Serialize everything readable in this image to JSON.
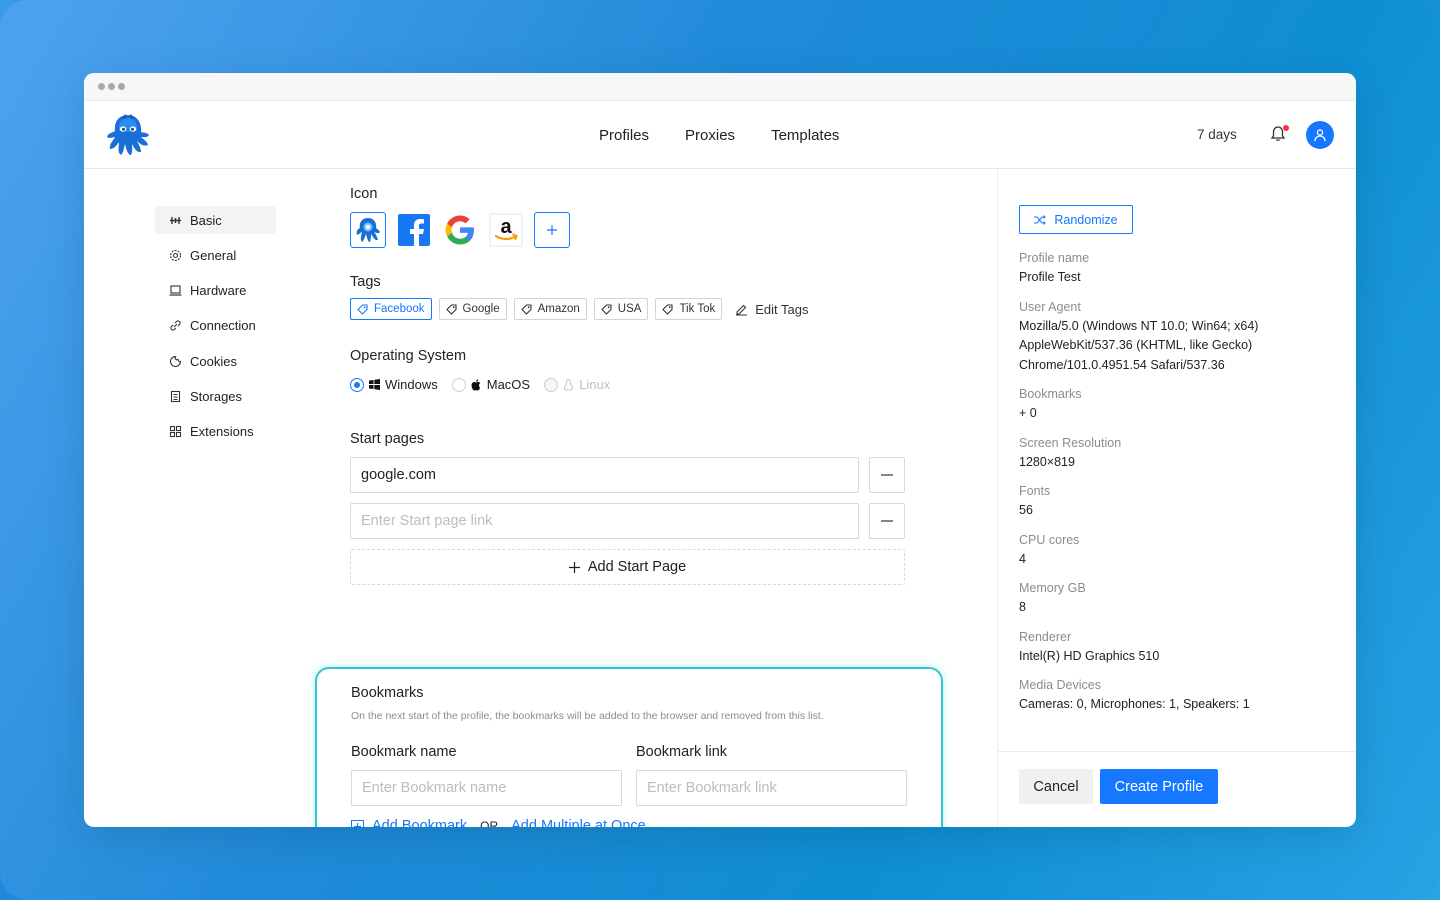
{
  "header": {
    "nav": [
      "Profiles",
      "Proxies",
      "Templates"
    ],
    "days": "7 days"
  },
  "sidebar": {
    "items": [
      {
        "label": "Basic",
        "icon": "sliders-icon"
      },
      {
        "label": "General",
        "icon": "gear-icon"
      },
      {
        "label": "Hardware",
        "icon": "laptop-icon"
      },
      {
        "label": "Connection",
        "icon": "link-icon"
      },
      {
        "label": "Cookies",
        "icon": "cookie-icon"
      },
      {
        "label": "Storages",
        "icon": "storage-icon"
      },
      {
        "label": "Extensions",
        "icon": "grid-icon"
      }
    ]
  },
  "form": {
    "icon_label": "Icon",
    "tags_label": "Tags",
    "tags": [
      "Facebook",
      "Google",
      "Amazon",
      "USA",
      "Tik Tok"
    ],
    "edit_tags": "Edit Tags",
    "os_label": "Operating System",
    "os_options": [
      "Windows",
      "MacOS",
      "Linux"
    ],
    "start_pages_label": "Start pages",
    "start_page_value": "google.com",
    "start_page_placeholder": "Enter Start page link",
    "add_start_page": "Add Start Page"
  },
  "bookmarks": {
    "title": "Bookmarks",
    "description": "On the next start of the profile, the bookmarks will be added to the browser and removed from this list.",
    "name_label": "Bookmark name",
    "link_label": "Bookmark link",
    "name_placeholder": "Enter Bookmark name",
    "link_placeholder": "Enter Bookmark link",
    "add_bookmark": "Add Bookmark",
    "or": "OR",
    "add_multiple": "Add Multiple at Once"
  },
  "summary": {
    "randomize": "Randomize",
    "profile_name_k": "Profile name",
    "profile_name_v": "Profile Test",
    "ua_k": "User Agent",
    "ua_v1": "Mozilla/5.0 (Windows NT 10.0; Win64; x64)",
    "ua_v2": "AppleWebKit/537.36 (KHTML, like Gecko)",
    "ua_v3": "Chrome/101.0.4951.54 Safari/537.36",
    "bookmarks_k": "Bookmarks",
    "bookmarks_v": "+ 0",
    "res_k": "Screen Resolution",
    "res_v": "1280×819",
    "fonts_k": "Fonts",
    "fonts_v": "56",
    "cpu_k": "CPU cores",
    "cpu_v": "4",
    "mem_k": "Memory GB",
    "mem_v": "8",
    "renderer_k": "Renderer",
    "renderer_v": "Intel(R) HD Graphics 510",
    "media_k": "Media Devices",
    "media_v": "Cameras: 0, Microphones: 1, Speakers: 1"
  },
  "footer": {
    "cancel": "Cancel",
    "create": "Create Profile"
  },
  "colors": {
    "accent": "#1677ff",
    "highlight": "#35c6d4"
  }
}
